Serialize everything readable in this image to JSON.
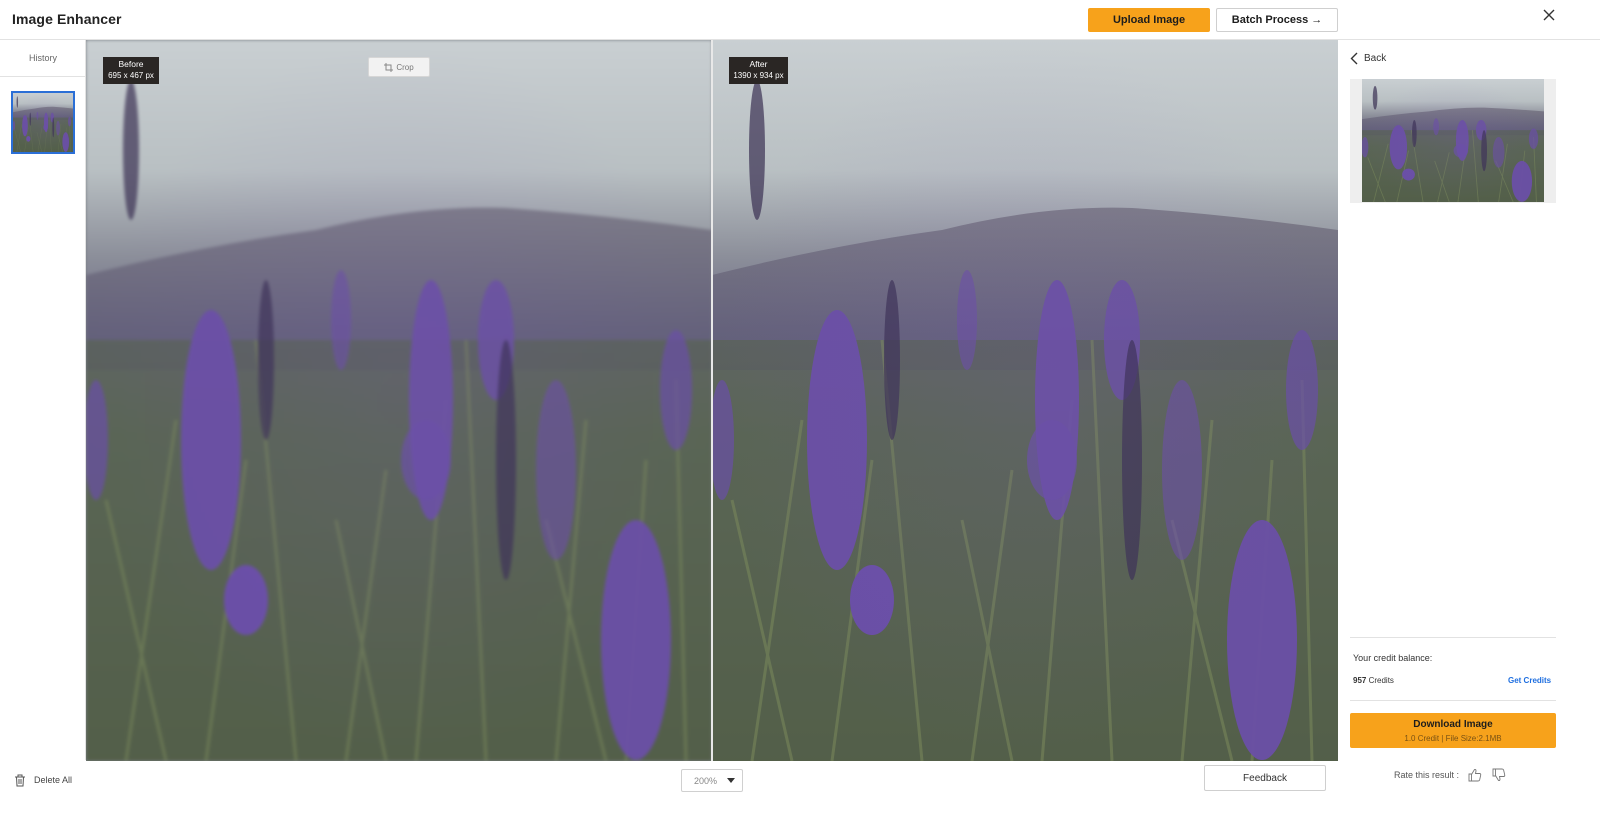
{
  "app": {
    "title": "Image Enhancer"
  },
  "header": {
    "upload_label": "Upload Image",
    "batch_label": "Batch Process",
    "batch_arrow": "→"
  },
  "history": {
    "tab_label": "History"
  },
  "compare": {
    "before": {
      "label": "Before",
      "size": "695 x 467 px"
    },
    "after": {
      "label": "After",
      "size": "1390 x 934 px"
    },
    "crop_label": "Crop"
  },
  "bottom": {
    "delete_all_label": "Delete All",
    "zoom_value": "200%",
    "feedback_label": "Feedback"
  },
  "right_panel": {
    "back_label": "Back",
    "credit_label": "Your credit balance:",
    "credit_count": "957",
    "credit_unit": "Credits",
    "get_credits_label": "Get Credits",
    "download_label": "Download Image",
    "download_sub": "1.0 Credit | File Size:2.1MB",
    "rate_label": "Rate this result :"
  },
  "colors": {
    "accent": "#f7a21b",
    "link": "#1f6fe0",
    "selected_border": "#2b6fd6"
  },
  "icons": [
    "close-icon",
    "arrow-right-icon",
    "crop-icon",
    "trash-icon",
    "chevron-down-icon",
    "chevron-left-icon",
    "thumbs-up-icon",
    "thumbs-down-icon"
  ]
}
